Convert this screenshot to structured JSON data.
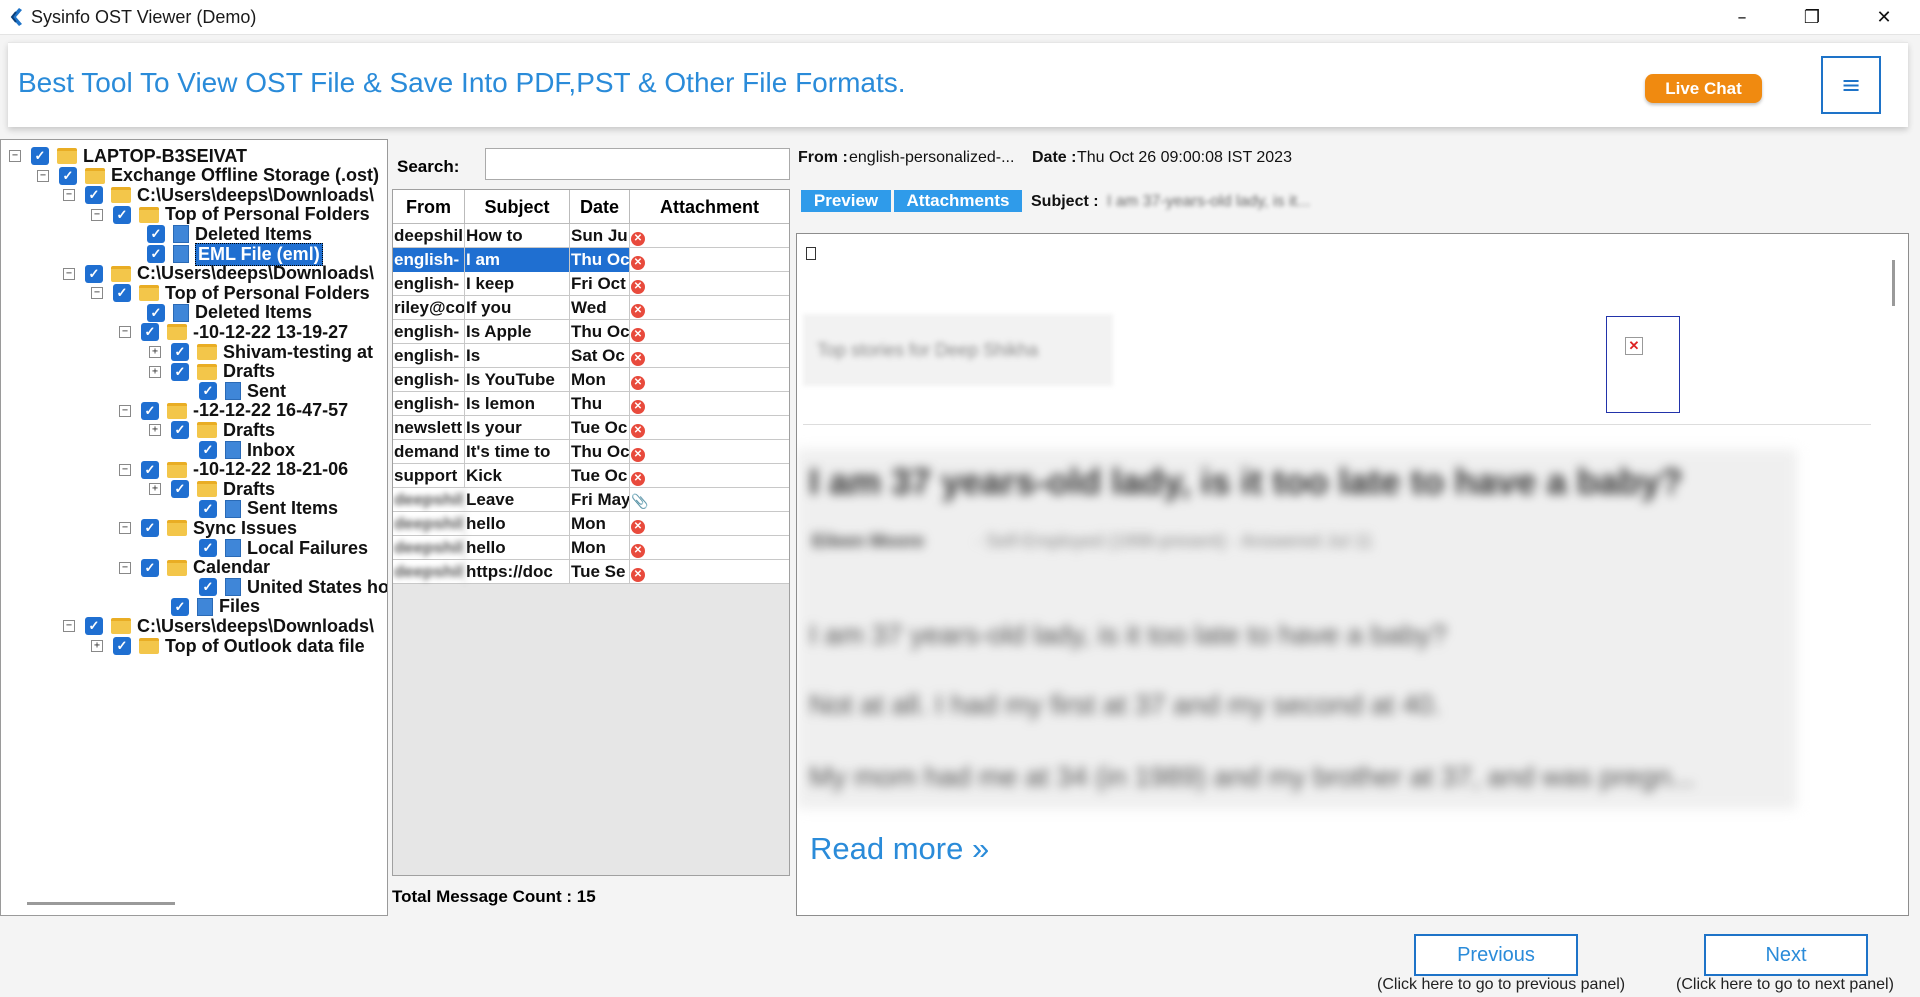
{
  "window": {
    "title": "Sysinfo OST Viewer (Demo)"
  },
  "header": {
    "tagline": "Best Tool To View OST File & Save Into PDF,PST & Other File Formats.",
    "live_chat": "Live Chat",
    "menu_icon": "≡"
  },
  "tree": [
    {
      "label": "LAPTOP-B3SEIVAT",
      "expander": "−"
    },
    {
      "label": "Exchange Offline Storage (.ost)",
      "expander": "−"
    },
    {
      "label": "C:\\Users\\deeps\\Downloads\\",
      "expander": "−"
    },
    {
      "label": "Top of Personal Folders",
      "expander": "−"
    },
    {
      "label": "Deleted Items",
      "expander": ""
    },
    {
      "label": "EML File (eml)",
      "expander": ""
    },
    {
      "label": "C:\\Users\\deeps\\Downloads\\",
      "expander": "−"
    },
    {
      "label": "Top of Personal Folders",
      "expander": "−"
    },
    {
      "label": "Deleted Items",
      "expander": ""
    },
    {
      "label": "-10-12-22 13-19-27",
      "expander": "−"
    },
    {
      "label": "Shivam-testing at",
      "expander": "+"
    },
    {
      "label": "Drafts",
      "expander": "+"
    },
    {
      "label": "Sent",
      "expander": ""
    },
    {
      "label": "-12-12-22 16-47-57",
      "expander": "−"
    },
    {
      "label": "Drafts",
      "expander": "+"
    },
    {
      "label": "Inbox",
      "expander": ""
    },
    {
      "label": "-10-12-22 18-21-06",
      "expander": "−"
    },
    {
      "label": "Drafts",
      "expander": "+"
    },
    {
      "label": "Sent Items",
      "expander": ""
    },
    {
      "label": "Sync Issues",
      "expander": "−"
    },
    {
      "label": "Local Failures",
      "expander": ""
    },
    {
      "label": "Calendar",
      "expander": "−"
    },
    {
      "label": "United States holi",
      "expander": ""
    },
    {
      "label": "Files",
      "expander": ""
    },
    {
      "label": "C:\\Users\\deeps\\Downloads\\",
      "expander": "−"
    },
    {
      "label": "Top of Outlook data file",
      "expander": "+"
    }
  ],
  "search": {
    "label": "Search:",
    "value": ""
  },
  "grid": {
    "columns": [
      "From",
      "Subject",
      "Date",
      "Attachment"
    ],
    "rows": [
      {
        "from": "deepshil",
        "subject": "How to",
        "date": "Sun Ju",
        "att": "x"
      },
      {
        "from": "english-",
        "subject": "I am",
        "date": "Thu Oc",
        "att": "x"
      },
      {
        "from": "english-",
        "subject": "I keep",
        "date": "Fri Oct",
        "att": "x"
      },
      {
        "from": "riley@co",
        "subject": "If you",
        "date": "Wed",
        "att": "x"
      },
      {
        "from": "english-",
        "subject": "Is Apple",
        "date": "Thu Oc",
        "att": "x"
      },
      {
        "from": "english-",
        "subject": "Is",
        "date": "Sat Oc",
        "att": "x"
      },
      {
        "from": "english-",
        "subject": "Is YouTube",
        "date": "Mon",
        "att": "x"
      },
      {
        "from": "english-",
        "subject": "Is lemon",
        "date": "Thu",
        "att": "x"
      },
      {
        "from": "newslett",
        "subject": "Is your",
        "date": "Tue Oc",
        "att": "x"
      },
      {
        "from": "demand",
        "subject": "It's time to",
        "date": "Thu Oc",
        "att": "x"
      },
      {
        "from": "support",
        "subject": "Kick",
        "date": "Tue Oc",
        "att": "x"
      },
      {
        "from": "deepshil",
        "subject": "Leave",
        "date": "Fri May",
        "att": "clip"
      },
      {
        "from": "deepshil",
        "subject": "hello",
        "date": "Mon",
        "att": "x"
      },
      {
        "from": "deepshil",
        "subject": "hello",
        "date": "Mon",
        "att": "x"
      },
      {
        "from": "deepshil",
        "subject": "https://doc",
        "date": "Tue Se",
        "att": "x"
      }
    ],
    "total": "Total Message Count : 15"
  },
  "message": {
    "from_label": "From :",
    "from_value": "english-personalized-...",
    "date_label": "Date :",
    "date_value": "Thu Oct 26 09:00:08 IST 2023",
    "subject_label": "Subject :",
    "subject_value": "I am 37-years-old lady, is it...",
    "tab_preview": "Preview",
    "tab_attachments": "Attachments"
  },
  "preview": {
    "top_label": "Top stories for Deep Shikha",
    "headline": "I am 37 years-old lady, is it too late to have a baby?",
    "author": "Eileen Moore",
    "author_detail": "· Self-Employed (1998-present) · Answered Jul 11",
    "line1": "I am 37 years-old lady, is it too late to have a baby?",
    "line2": "Not at all. I had my first at 37 and my second at 40.",
    "line3": "My mom had me at 34 (in 1989) and my brother at 37, and was pregn...",
    "read_more": "Read more »"
  },
  "nav": {
    "previous": "Previous",
    "previous_hint": "(Click here to go to previous panel)",
    "next": "Next",
    "next_hint": "(Click here to go to next panel)"
  }
}
